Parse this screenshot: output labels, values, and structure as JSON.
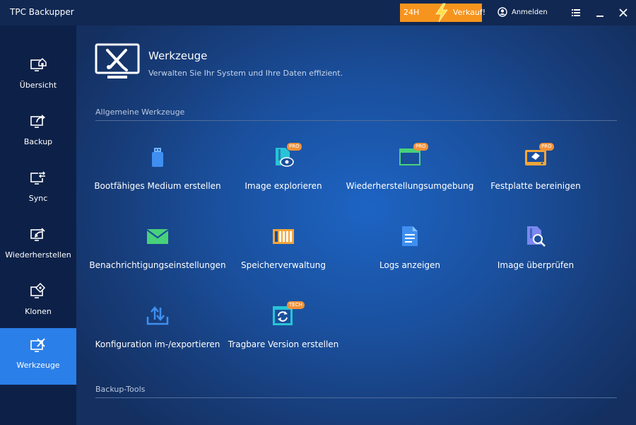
{
  "app": {
    "title": "TPC Backupper"
  },
  "promo": {
    "hours": "24H",
    "label": "Verkauf!"
  },
  "titlebar": {
    "login_label": "Anmelden"
  },
  "sidebar": {
    "items": [
      {
        "label": "Übersicht",
        "icon": "monitor-home-icon"
      },
      {
        "label": "Backup",
        "icon": "monitor-export-icon"
      },
      {
        "label": "Sync",
        "icon": "monitor-sync-icon"
      },
      {
        "label": "Wiederherstellen",
        "icon": "monitor-restore-icon"
      },
      {
        "label": "Klonen",
        "icon": "monitor-clone-icon"
      },
      {
        "label": "Werkzeuge",
        "icon": "monitor-tools-icon",
        "active": true
      }
    ]
  },
  "header": {
    "title": "Werkzeuge",
    "subtitle": "Verwalten Sie Ihr System und Ihre Daten effizient."
  },
  "sections": {
    "general": "Allgemeine Werkzeuge",
    "backup": "Backup-Tools"
  },
  "tools": [
    {
      "label": "Bootfähiges Medium erstellen",
      "icon": "usb-drive-icon"
    },
    {
      "label": "Image explorieren",
      "icon": "image-explore-icon",
      "badge": "PRO"
    },
    {
      "label": "Wiederherstellungsumgebung",
      "icon": "recovery-window-icon",
      "badge": "PRO"
    },
    {
      "label": "Festplatte bereinigen",
      "icon": "disk-eraser-icon",
      "badge": "PRO"
    },
    {
      "label": "Benachrichtigungseinstellungen",
      "icon": "mail-icon"
    },
    {
      "label": "Speicherverwaltung",
      "icon": "storage-icon"
    },
    {
      "label": "Logs anzeigen",
      "icon": "log-document-icon"
    },
    {
      "label": "Image überprüfen",
      "icon": "image-check-icon"
    },
    {
      "label": "Konfiguration im-/exportieren",
      "icon": "import-export-icon"
    },
    {
      "label": "Tragbare Version erstellen",
      "icon": "portable-version-icon",
      "badge": "TECH"
    }
  ],
  "colors": {
    "accent": "#2b7fe8",
    "promo": "#f7941d",
    "badge": "#f0923a",
    "icon_blue": "#3f8ff0",
    "icon_green": "#48d17a",
    "icon_orange": "#f3a53a",
    "icon_cyan": "#27c4d6"
  }
}
